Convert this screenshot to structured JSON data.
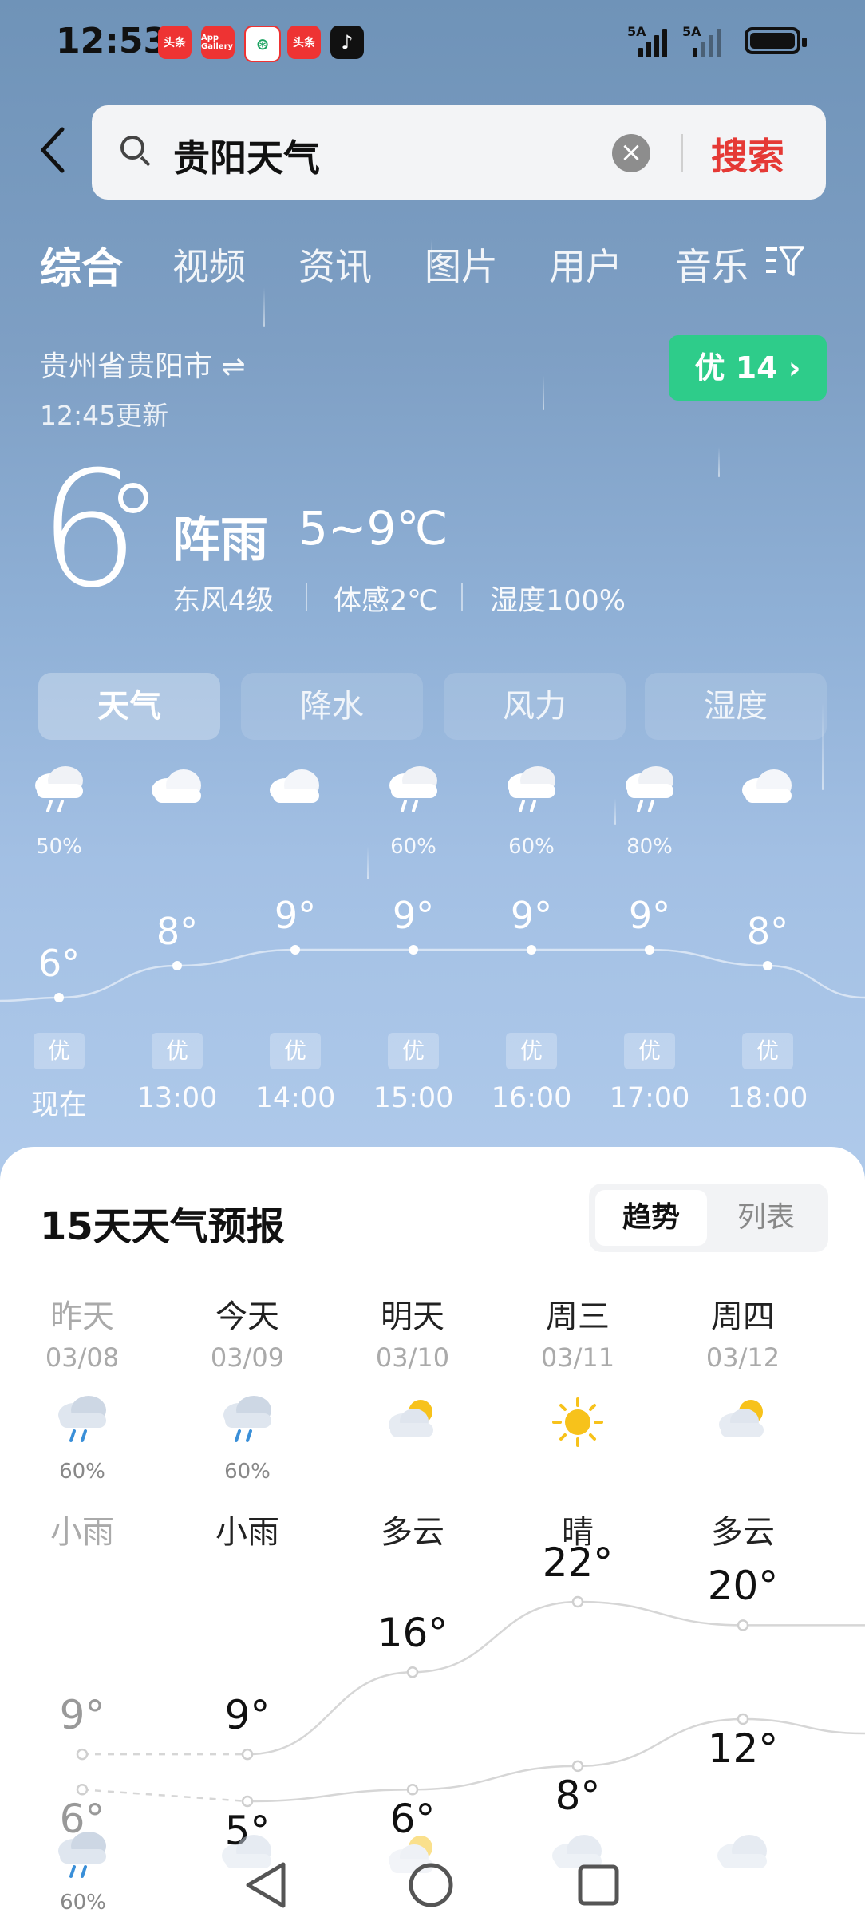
{
  "status_bar": {
    "time": "12:53",
    "apps": [
      "头条",
      "App Gallery",
      "",
      "头条",
      "♪"
    ],
    "signal1": "5A",
    "signal2": "5A"
  },
  "search": {
    "query": "贵阳天气",
    "button": "搜索"
  },
  "tabs": [
    "综合",
    "视频",
    "资讯",
    "图片",
    "用户",
    "音乐"
  ],
  "location": {
    "city": "贵州省贵阳市 ⇌",
    "updated": "12:45更新",
    "aqi": "优 14 ›"
  },
  "current": {
    "temp": "6",
    "condition": "阵雨",
    "range": "5~9℃",
    "wind": "东风4级",
    "feels": "体感2℃",
    "humidity": "湿度100%"
  },
  "segments": [
    "天气",
    "降水",
    "风力",
    "湿度"
  ],
  "hourly": [
    {
      "time": "现在",
      "temp": "6°",
      "pct": "50%",
      "aqi": "优",
      "icon": "rain-cloud-icon"
    },
    {
      "time": "13:00",
      "temp": "8°",
      "pct": "",
      "aqi": "优",
      "icon": "cloud-icon"
    },
    {
      "time": "14:00",
      "temp": "9°",
      "pct": "",
      "aqi": "优",
      "icon": "cloud-icon"
    },
    {
      "time": "15:00",
      "temp": "9°",
      "pct": "60%",
      "aqi": "优",
      "icon": "rain-cloud-icon"
    },
    {
      "time": "16:00",
      "temp": "9°",
      "pct": "60%",
      "aqi": "优",
      "icon": "rain-cloud-icon"
    },
    {
      "time": "17:00",
      "temp": "9°",
      "pct": "80%",
      "aqi": "优",
      "icon": "rain-cloud-icon"
    },
    {
      "time": "18:00",
      "temp": "8°",
      "pct": "",
      "aqi": "优",
      "icon": "cloud-icon"
    }
  ],
  "forecast": {
    "title": "15天天气预报",
    "toggle": [
      "趋势",
      "列表"
    ],
    "days": [
      {
        "day": "昨天",
        "date": "03/08",
        "pct": "60%",
        "cond": "小雨",
        "high": "9°",
        "low": "6°",
        "icon": "rain-cloud-icon"
      },
      {
        "day": "今天",
        "date": "03/09",
        "pct": "60%",
        "cond": "小雨",
        "high": "9°",
        "low": "5°",
        "icon": "rain-cloud-icon"
      },
      {
        "day": "明天",
        "date": "03/10",
        "pct": "",
        "cond": "多云",
        "high": "16°",
        "low": "6°",
        "icon": "sun-cloud-icon"
      },
      {
        "day": "周三",
        "date": "03/11",
        "pct": "",
        "cond": "晴",
        "high": "22°",
        "low": "8°",
        "icon": "sun-icon"
      },
      {
        "day": "周四",
        "date": "03/12",
        "pct": "",
        "cond": "多云",
        "high": "20°",
        "low": "12°",
        "icon": "sun-cloud-icon"
      }
    ],
    "next_pct": "60%"
  }
}
